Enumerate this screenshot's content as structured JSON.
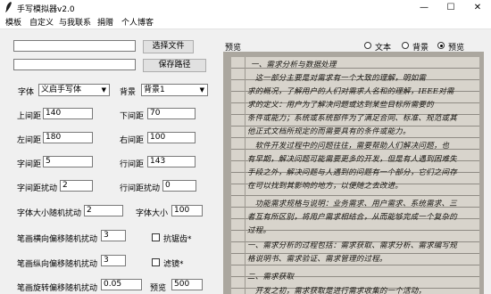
{
  "window": {
    "title": "手写模拟器v2.0",
    "minimize": "—",
    "maximize": "☐",
    "close": "✕"
  },
  "menu": [
    "模板",
    "自定义",
    "与我联系",
    "捐赠",
    "个人博客"
  ],
  "file": {
    "choose_button": "选择文件",
    "save_button": "保存路径",
    "file_path": "",
    "save_path": ""
  },
  "font": {
    "label": "字体",
    "value": "义启手写体"
  },
  "background": {
    "label": "背景",
    "value": "背景1"
  },
  "params": {
    "top_margin": {
      "label": "上间距",
      "value": "140"
    },
    "bottom_margin": {
      "label": "下间距",
      "value": "70"
    },
    "left_margin": {
      "label": "左间距",
      "value": "180"
    },
    "right_margin": {
      "label": "右间距",
      "value": "100"
    },
    "char_spacing": {
      "label": "字间距",
      "value": "5"
    },
    "line_spacing": {
      "label": "行间距",
      "value": "143"
    },
    "char_spacing_jitter": {
      "label": "字间距扰动",
      "value": "2"
    },
    "line_spacing_jitter": {
      "label": "行间距扰动",
      "value": "0"
    },
    "font_size_jitter": {
      "label": "字体大小随机扰动",
      "value": "2"
    },
    "font_size": {
      "label": "字体大小",
      "value": "100"
    },
    "stroke_h_offset": {
      "label": "笔画横向偏移随机扰动",
      "value": "3"
    },
    "stroke_v_offset": {
      "label": "笔画纵向偏移随机扰动",
      "value": "3"
    },
    "stroke_rotate": {
      "label": "笔画旋转偏移随机扰动",
      "value": "0.05"
    },
    "preview": {
      "label": "预览",
      "value": "500"
    }
  },
  "checkboxes": {
    "antialias": "抗锯齿*",
    "filter": "滤镜*"
  },
  "preview_section": {
    "title": "预览",
    "modes": [
      "文本",
      "背景",
      "预览"
    ],
    "selected": "预览"
  },
  "handwriting": [
    "一、需求分析与数据处理",
    "　这一部分主要是对需求有一个大致的理解，明如需",
    "求的概况，了解用户的人们对需求人名和的理解，IEEE对需",
    "求的定义：用户为了解决问题或达到某些目标所需要的",
    "条件或能力；系统或系统部件为了满足合同、标准、规范或其",
    "他正式文档所规定的而需要具有的条件或能力。",
    "　软件开发过程中的问题往往，需要帮助人们解决问题，也",
    "有早期，解决问题可能需要更多的开发，但是有人遇到困难失",
    "手段之外，解决问题与人遇到的问题有一个部分，它们之间存",
    "在可以找到其影响的地方，以便随之去改进。",
    "　功能需求规格与说明：业务需求、用户需求、系统需求、三",
    "者互有所区别，将用户需求相结合，从而能够完成一个复杂的",
    "过程。",
    "一、需求分析的过程包括：需求获取、需求分析、需求编写规",
    "格说明书、需求验证、需求管理的过程。",
    "二、需求获取",
    "　开发之初，需求获取是进行需求收集的一个活动，"
  ]
}
